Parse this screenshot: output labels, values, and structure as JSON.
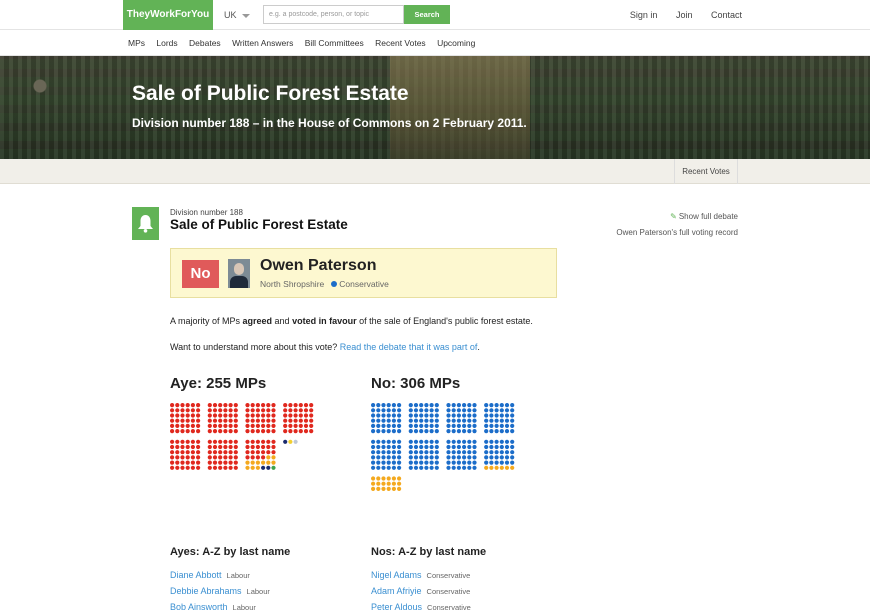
{
  "header": {
    "logo": "TheyWorkForYou",
    "country": "UK",
    "search_placeholder": "e.g. a postcode, person, or topic",
    "search_button": "Search",
    "links": [
      "Sign in",
      "Join",
      "Contact"
    ]
  },
  "nav": [
    "MPs",
    "Lords",
    "Debates",
    "Written Answers",
    "Bill Committees",
    "Recent Votes",
    "Upcoming"
  ],
  "hero": {
    "title": "Sale of Public Forest Estate",
    "subtitle": "Division number 188 – in the House of Commons on 2 February 2011."
  },
  "subbar": {
    "recent_votes": "Recent Votes"
  },
  "division": {
    "number_label": "Division number 188",
    "title": "Sale of Public Forest Estate",
    "show_debate": "Show full debate",
    "voting_record": "Owen Paterson's full voting record"
  },
  "mp": {
    "vote": "No",
    "name": "Owen Paterson",
    "constituency": "North Shropshire",
    "party": "Conservative",
    "party_color": "#1c6dc9"
  },
  "summary": {
    "part1": "A majority of MPs ",
    "bold1": "agreed",
    "part2": " and ",
    "bold2": "voted in favour",
    "part3": " of the sale of England's public forest estate.",
    "more_prefix": "Want to understand more about this vote? ",
    "more_link": "Read the debate that it was part of",
    "more_suffix": "."
  },
  "votes": {
    "aye_label": "Aye: 255 MPs",
    "no_label": "No: 306 MPs",
    "colors": {
      "labour": "#e0281e",
      "conservative": "#1c6dc9",
      "libdem": "#f4a91e",
      "other_navy": "#1a2b6e",
      "other_green": "#3fa34d",
      "other_yellow": "#f2cf2f",
      "other_grey": "#bfc8d6"
    },
    "aye_breakdown": {
      "labour": 238,
      "libdem": 11,
      "other": 6
    },
    "no_breakdown": {
      "conservative": 282,
      "libdem": 24
    }
  },
  "lists": {
    "aye_heading": "Ayes: A-Z by last name",
    "no_heading": "Nos: A-Z by last name",
    "ayes": [
      {
        "name": "Diane Abbott",
        "party": "Labour"
      },
      {
        "name": "Debbie Abrahams",
        "party": "Labour"
      },
      {
        "name": "Bob Ainsworth",
        "party": "Labour"
      }
    ],
    "nos": [
      {
        "name": "Nigel Adams",
        "party": "Conservative"
      },
      {
        "name": "Adam Afriyie",
        "party": "Conservative"
      },
      {
        "name": "Peter Aldous",
        "party": "Conservative"
      }
    ]
  }
}
